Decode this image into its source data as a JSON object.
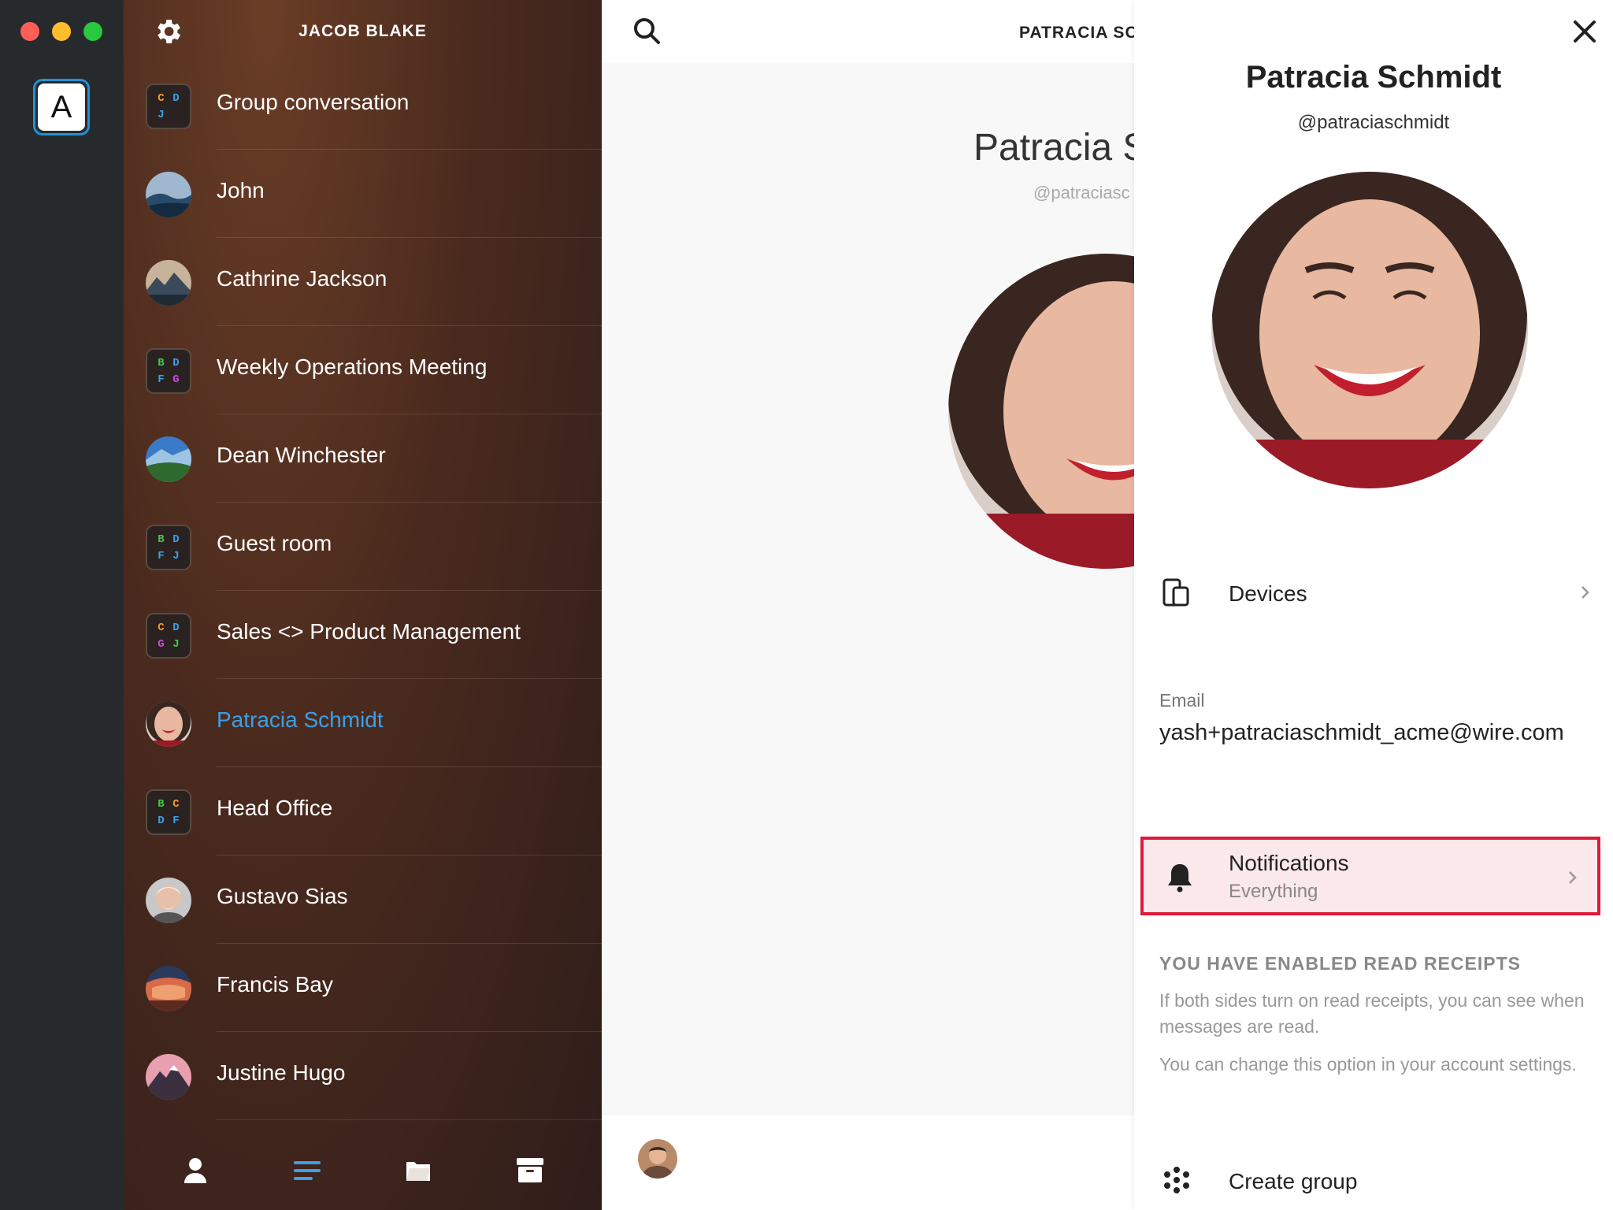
{
  "window": {
    "traffic_lights": [
      "close",
      "minimize",
      "zoom"
    ]
  },
  "account": {
    "initial": "A",
    "ring_color": "#2391d3"
  },
  "list": {
    "header": "JACOB BLAKE",
    "settings_icon": "gear-icon",
    "items": [
      {
        "label": "Group conversation",
        "type": "group",
        "letters": [
          "C",
          "D",
          "J",
          ""
        ],
        "letter_colors": [
          "#f59a23",
          "#3aa0e8",
          "#3aa0e8",
          ""
        ]
      },
      {
        "label": "John",
        "type": "user",
        "avatar": "landscape-sky"
      },
      {
        "label": "Cathrine Jackson",
        "type": "user",
        "avatar": "landscape-mountain"
      },
      {
        "label": "Weekly Operations Meeting",
        "type": "group",
        "letters": [
          "B",
          "D",
          "F",
          "G"
        ],
        "letter_colors": [
          "#40c84a",
          "#3aa0e8",
          "#3aa0e8",
          "#c84ae0"
        ]
      },
      {
        "label": "Dean Winchester",
        "type": "user",
        "avatar": "landscape-green"
      },
      {
        "label": "Guest room",
        "type": "group",
        "letters": [
          "B",
          "D",
          "F",
          "J"
        ],
        "letter_colors": [
          "#40c84a",
          "#3aa0e8",
          "#3aa0e8",
          "#3aa0e8"
        ]
      },
      {
        "label": "Sales <> Product Management",
        "type": "group",
        "letters": [
          "C",
          "D",
          "G",
          "J"
        ],
        "letter_colors": [
          "#f59a23",
          "#3aa0e8",
          "#c84ae0",
          "#40c84a"
        ]
      },
      {
        "label": "Patracia Schmidt",
        "type": "user",
        "avatar": "face-woman",
        "active": true
      },
      {
        "label": "Head Office",
        "type": "group",
        "letters": [
          "B",
          "C",
          "D",
          "F"
        ],
        "letter_colors": [
          "#40c84a",
          "#f59a23",
          "#3aa0e8",
          "#3aa0e8"
        ]
      },
      {
        "label": "Gustavo Sias",
        "type": "user",
        "avatar": "face-man"
      },
      {
        "label": "Francis Bay",
        "type": "user",
        "avatar": "landscape-canyon"
      },
      {
        "label": "Justine Hugo",
        "type": "user",
        "avatar": "landscape-peak"
      }
    ],
    "bottom_icons": [
      "person-icon",
      "conversations-icon",
      "folder-icon",
      "archive-icon"
    ],
    "active_bottom": "conversations-icon"
  },
  "center": {
    "title": "PATRACIA SC",
    "name": "Patracia Sc",
    "handle": "@patraciasc"
  },
  "panel": {
    "name": "Patracia Schmidt",
    "handle": "@patraciaschmidt",
    "devices_label": "Devices",
    "email_label": "Email",
    "email_value": "yash+patraciaschmidt_acme@wire.com",
    "notifications_label": "Notifications",
    "notifications_value": "Everything",
    "read_receipts_heading": "YOU HAVE ENABLED READ RECEIPTS",
    "read_receipts_text1": "If both sides turn on read receipts, you can see when messages are read.",
    "read_receipts_text2": "You can change this option in your account settings.",
    "create_group_label": "Create group",
    "highlight_color": "#e0193a"
  }
}
